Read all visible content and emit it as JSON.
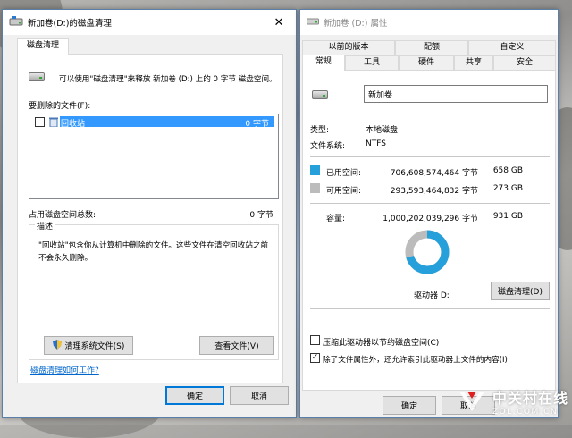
{
  "cleanup": {
    "title": "新加卷(D:)的磁盘清理",
    "tab": "磁盘清理",
    "intro": "可以使用\"磁盘清理\"来释放 新加卷 (D:) 上的 0 字节 磁盘空间。",
    "files_label": "要删除的文件(F):",
    "items": [
      {
        "name": "回收站",
        "size": "0 字节",
        "checked": false
      }
    ],
    "total_label": "占用磁盘空间总数:",
    "total_value": "0 字节",
    "description_title": "描述",
    "description_text_1": "\"回收站\"包含你从计算机中删除的文件。这些文件在清空回收站之前",
    "description_text_2": "不会永久删除。",
    "clean_system_button": "清理系统文件(S)",
    "view_files_button": "查看文件(V)",
    "help_link": "磁盘清理如何工作?",
    "ok_button": "确定",
    "cancel_button": "取消"
  },
  "props": {
    "title": "新加卷 (D:) 属性",
    "tabs_top": [
      "以前的版本",
      "配额",
      "自定义"
    ],
    "tabs_bottom": [
      "常规",
      "工具",
      "硬件",
      "共享",
      "安全"
    ],
    "volume_name": "新加卷",
    "type_label": "类型:",
    "type_value": "本地磁盘",
    "fs_label": "文件系统:",
    "fs_value": "NTFS",
    "used_label": "已用空间:",
    "used_bytes": "706,608,574,464 字节",
    "used_size": "658 GB",
    "free_label": "可用空间:",
    "free_bytes": "293,593,464,832 字节",
    "free_size": "273 GB",
    "capacity_label": "容量:",
    "capacity_bytes": "1,000,202,039,296 字节",
    "capacity_size": "931 GB",
    "used_fraction": 0.7065,
    "drive_label": "驱动器 D:",
    "cleanup_button": "磁盘清理(D)",
    "compress_label": "压缩此驱动器以节约磁盘空间(C)",
    "compress_checked": false,
    "index_label": "除了文件属性外，还允许索引此驱动器上文件的内容(I)",
    "index_checked": true,
    "ok_button": "确定",
    "cancel_button": "取消",
    "used_color": "#26a0da",
    "free_color": "#bcbcbc"
  },
  "watermark": {
    "name": "中关村在线",
    "domain": "ZOL.COM.CN"
  }
}
